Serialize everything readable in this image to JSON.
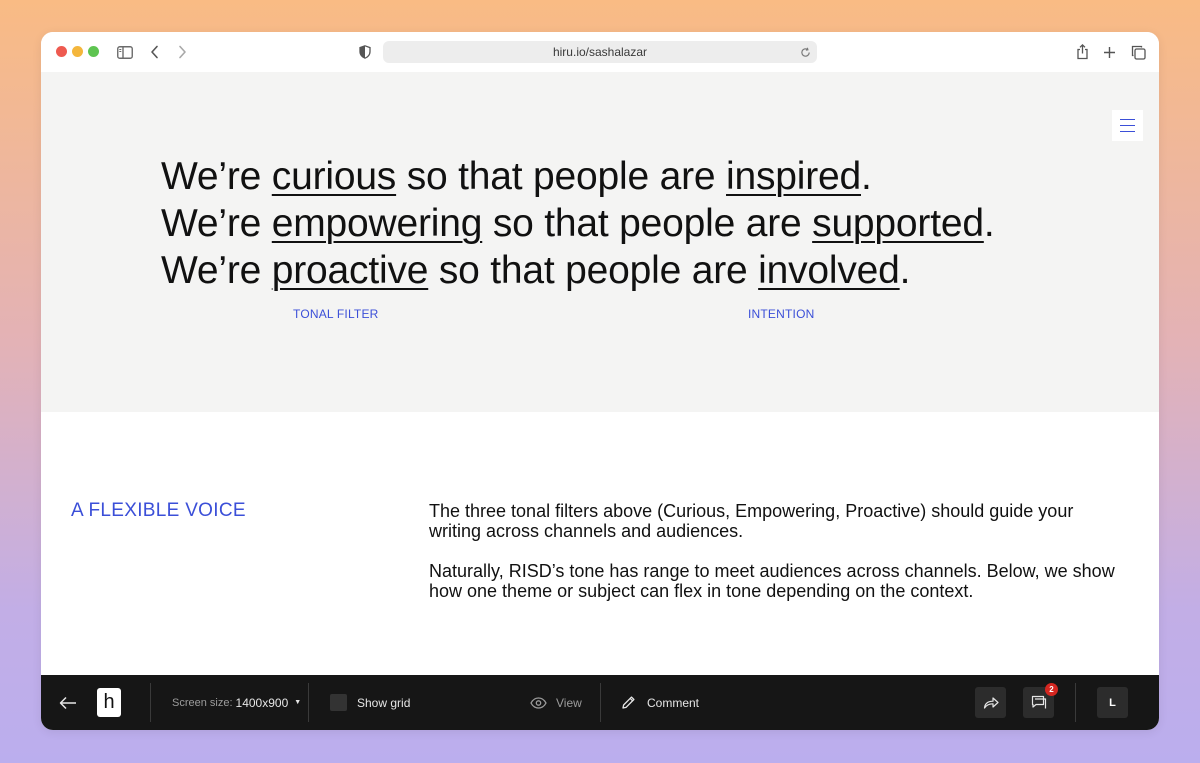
{
  "browser": {
    "url": "hiru.io/sashalazar",
    "icons": [
      "sidebar-icon",
      "back-icon",
      "forward-icon",
      "shield-icon",
      "reload-icon",
      "share-icon",
      "new-tab-icon",
      "tabs-icon"
    ]
  },
  "hero": {
    "lines": [
      {
        "prefix": "We’re ",
        "tone": "curious",
        "middle": " so that people are ",
        "intent": "inspired",
        "suffix": "."
      },
      {
        "prefix": "We’re ",
        "tone": "empowering",
        "middle": " so that people are ",
        "intent": "supported",
        "suffix": "."
      },
      {
        "prefix": "We’re ",
        "tone": "proactive",
        "middle": " so that people are ",
        "intent": "involved",
        "suffix": "."
      }
    ],
    "caption_left": "TONAL FILTER",
    "caption_right": "INTENTION"
  },
  "section": {
    "title": "A FLEXIBLE VOICE",
    "paragraphs": [
      "The three tonal filters above (Curious, Empowering, Proactive) should guide your writing across channels and audiences.",
      "Naturally, RISD’s tone has range to meet audiences across channels. Below, we show how one theme or subject can flex in tone depending on the context."
    ]
  },
  "bottombar": {
    "logo": "h",
    "screen_size_label": "Screen size:",
    "screen_size_value": "1400x900",
    "show_grid": "Show grid",
    "view": "View",
    "comment": "Comment",
    "comment_count": "2",
    "avatar": "L"
  },
  "colors": {
    "accent": "#3b4fd8",
    "hero_bg": "#f4f4f3",
    "bar_bg": "#161616",
    "badge": "#d42620"
  }
}
